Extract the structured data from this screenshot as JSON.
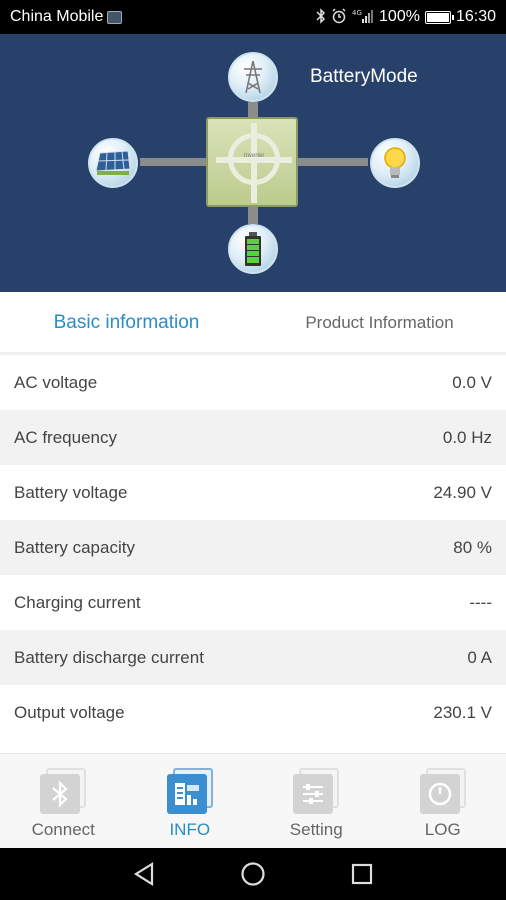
{
  "status_bar": {
    "carrier": "China Mobile",
    "battery_percent": "100%",
    "time": "16:30",
    "icons": [
      "bluetooth-icon",
      "alarm-icon",
      "signal-icon",
      "battery-icon"
    ]
  },
  "header": {
    "mode_label": "BatteryMode",
    "nodes": [
      "grid-tower-icon",
      "solar-panel-icon",
      "bulb-icon",
      "battery-icon"
    ]
  },
  "tabs": [
    {
      "label": "Basic information",
      "active": true
    },
    {
      "label": "Product Information",
      "active": false
    }
  ],
  "info": [
    {
      "label": "AC voltage",
      "value": "0.0 V"
    },
    {
      "label": "AC frequency",
      "value": "0.0 Hz"
    },
    {
      "label": "Battery voltage",
      "value": "24.90 V"
    },
    {
      "label": "Battery capacity",
      "value": "80 %"
    },
    {
      "label": "Charging current",
      "value": "----"
    },
    {
      "label": "Battery discharge current",
      "value": "0 A"
    },
    {
      "label": "Output voltage",
      "value": "230.1 V"
    }
  ],
  "bottom_nav": [
    {
      "label": "Connect",
      "icon": "bluetooth-icon",
      "active": false
    },
    {
      "label": "INFO",
      "icon": "info-chart-icon",
      "active": true
    },
    {
      "label": "Setting",
      "icon": "sliders-icon",
      "active": false
    },
    {
      "label": "LOG",
      "icon": "power-icon",
      "active": false
    }
  ],
  "colors": {
    "header_bg": "#27416b",
    "accent": "#2a8ec6",
    "row_alt": "#f2f2f2"
  }
}
